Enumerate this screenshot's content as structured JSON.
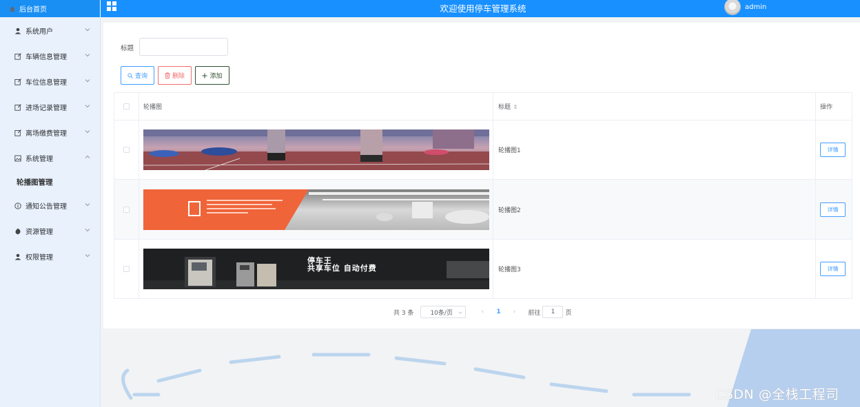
{
  "header": {
    "home_label": "后台首页",
    "title": "欢迎使用停车管理系统",
    "username": "admin",
    "brand_color": "#1890ff"
  },
  "sidebar": {
    "items": [
      {
        "label": "系统用户",
        "icon": "user-icon"
      },
      {
        "label": "车辆信息管理",
        "icon": "edit-icon"
      },
      {
        "label": "车位信息管理",
        "icon": "edit-icon"
      },
      {
        "label": "进场记录管理",
        "icon": "edit-icon"
      },
      {
        "label": "离场缴费管理",
        "icon": "edit-icon"
      },
      {
        "label": "系统管理",
        "icon": "picture-icon",
        "expanded": true
      },
      {
        "label": "通知公告管理",
        "icon": "info-icon"
      },
      {
        "label": "资源管理",
        "icon": "flag-icon"
      },
      {
        "label": "权限管理",
        "icon": "user-icon"
      }
    ],
    "active_sub_item": "轮播图管理"
  },
  "filter": {
    "label": "标题",
    "value": "",
    "placeholder": ""
  },
  "toolbar": {
    "query_label": "查询",
    "delete_label": "删除",
    "add_label": "添加"
  },
  "table": {
    "columns": [
      "轮播图",
      "标题",
      "操作"
    ],
    "rows": [
      {
        "image": "parking-garage-banner",
        "title": "轮播图1",
        "action": "详情"
      },
      {
        "image": "orange-parking-banner",
        "title": "轮播图2",
        "action": "详情"
      },
      {
        "image": "dark-kiosk-banner",
        "title": "轮播图3",
        "action": "详情",
        "banner_text": "停车王",
        "banner_subtext": "共享车位 自动付费"
      }
    ]
  },
  "pagination": {
    "total": "共 3 条",
    "page_size": "10条/页",
    "current_page": "1",
    "goto_label": "前往",
    "goto_value": "1",
    "page_suffix": "页"
  },
  "watermark": "CSDN @全栈工程司"
}
